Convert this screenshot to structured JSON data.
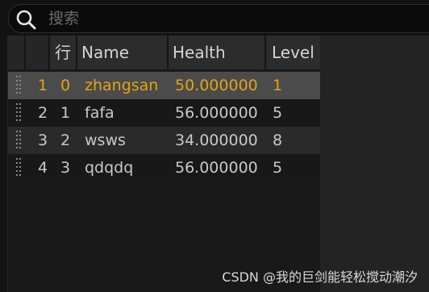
{
  "search": {
    "placeholder": "搜索"
  },
  "table": {
    "columns": [
      "行",
      "Name",
      "Health",
      "Level"
    ],
    "rows": [
      {
        "index": "1",
        "row": "0",
        "name": "zhangsan",
        "health": "50.000000",
        "level": "1",
        "selected": true
      },
      {
        "index": "2",
        "row": "1",
        "name": "fafa",
        "health": "56.000000",
        "level": "5",
        "selected": false
      },
      {
        "index": "3",
        "row": "2",
        "name": "wsws",
        "health": "34.000000",
        "level": "8",
        "selected": false
      },
      {
        "index": "4",
        "row": "3",
        "name": "qdqdq",
        "health": "56.000000",
        "level": "5",
        "selected": false
      }
    ]
  },
  "colors": {
    "selected_text": "#e3a413",
    "selected_row": "#4b4b4b"
  },
  "watermark": "CSDN @我的巨剑能轻松搅动潮汐"
}
